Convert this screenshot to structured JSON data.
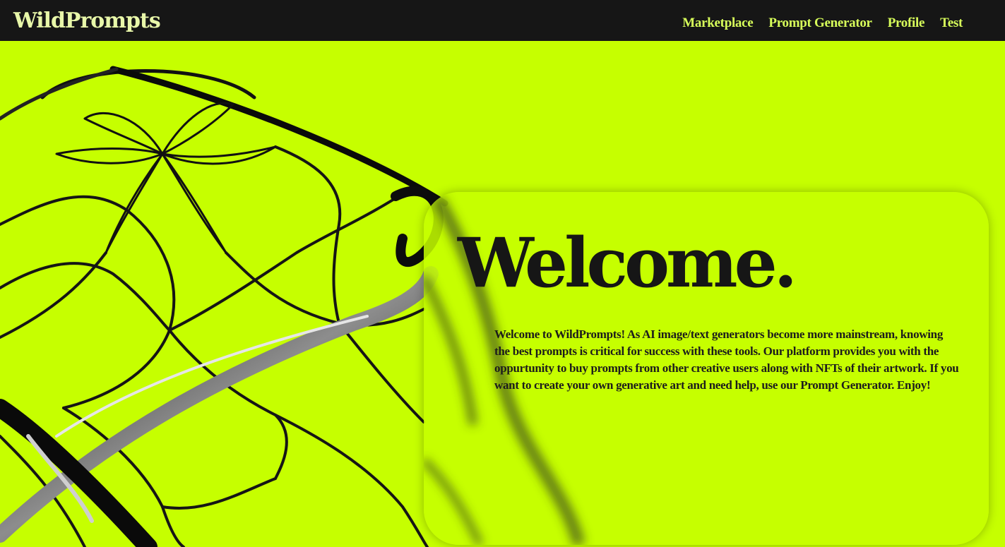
{
  "header": {
    "logo": "WildPrompts",
    "nav": [
      {
        "label": "Marketplace"
      },
      {
        "label": "Prompt Generator"
      },
      {
        "label": "Profile"
      },
      {
        "label": "Test"
      }
    ]
  },
  "hero": {
    "image_icon": "chain-link-fence-art",
    "title": "Welcome.",
    "body": "Welcome to WildPrompts! As AI image/text generators become more mainstream, knowing the best prompts is critical for success with these tools. Our platform provides you with the oppurtunity to buy prompts from other creative users along with NFTs of their artwork. If you want to create your own generative art and need help, use our Prompt Generator. Enjoy!"
  },
  "colors": {
    "accent": "#c6ff00",
    "header_bg": "#161616",
    "logo": "#e8f7a9",
    "nav_link": "#d8ff5a",
    "text_dark": "#161616"
  }
}
